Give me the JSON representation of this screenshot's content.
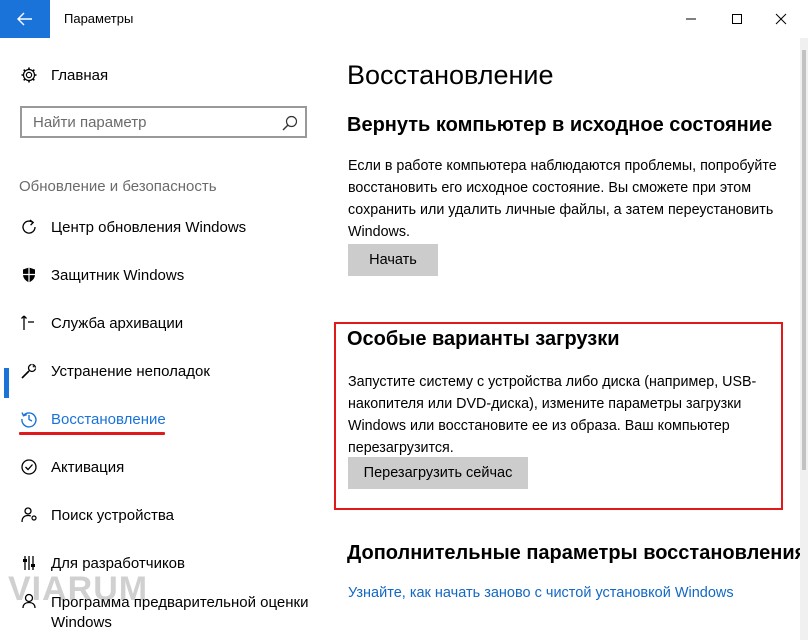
{
  "window": {
    "title": "Параметры"
  },
  "sidebar": {
    "home_label": "Главная",
    "search_placeholder": "Найти параметр",
    "section_label": "Обновление и безопасность",
    "items": [
      {
        "label": "Центр обновления Windows",
        "icon": "refresh-icon"
      },
      {
        "label": "Защитник Windows",
        "icon": "shield-icon"
      },
      {
        "label": "Служба архивации",
        "icon": "backup-arrow-icon"
      },
      {
        "label": "Устранение неполадок",
        "icon": "wrench-icon"
      },
      {
        "label": "Восстановление",
        "icon": "history-icon",
        "active": true
      },
      {
        "label": "Активация",
        "icon": "check-circle-icon"
      },
      {
        "label": "Поиск устройства",
        "icon": "person-location-icon"
      },
      {
        "label": "Для разработчиков",
        "icon": "developer-tools-icon"
      },
      {
        "label": "Программа предварительной оценки Windows",
        "icon": "insider-icon"
      }
    ]
  },
  "main": {
    "title": "Восстановление",
    "reset": {
      "heading": "Вернуть компьютер в исходное состояние",
      "text": "Если в работе компьютера наблюдаются проблемы, попробуйте восстановить его исходное состояние. Вы сможете при этом сохранить или удалить личные файлы, а затем переустановить Windows.",
      "button": "Начать"
    },
    "advanced_startup": {
      "heading": "Особые варианты загрузки",
      "text": "Запустите систему с устройства либо диска (например, USB-накопителя или DVD-диска), измените параметры загрузки Windows или восстановите ее из образа. Ваш компьютер перезагрузится.",
      "button": "Перезагрузить сейчас"
    },
    "more": {
      "heading": "Дополнительные параметры восстановления",
      "link": "Узнайте, как начать заново с чистой установкой Windows"
    }
  },
  "watermark": "VIARUM",
  "colors": {
    "accent": "#1a73d9",
    "highlight_red": "#e01a1a",
    "link": "#1368c4",
    "button_bg": "#cccccc"
  }
}
